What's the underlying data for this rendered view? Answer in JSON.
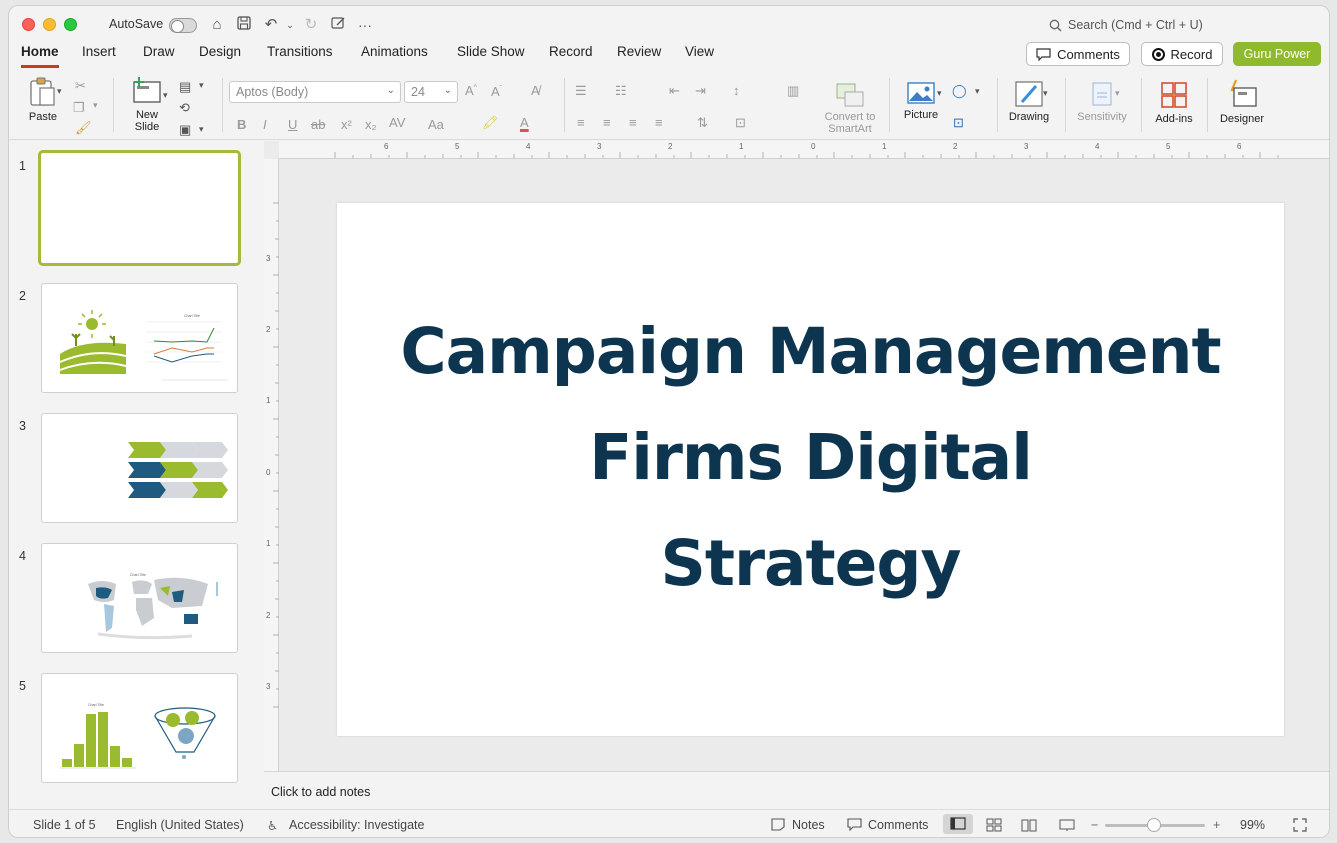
{
  "titlebar": {
    "autosave_label": "AutoSave",
    "search_placeholder": "Search (Cmd + Ctrl + U)"
  },
  "tabs": [
    {
      "label": "Home",
      "active": true
    },
    {
      "label": "Insert"
    },
    {
      "label": "Draw"
    },
    {
      "label": "Design"
    },
    {
      "label": "Transitions"
    },
    {
      "label": "Animations"
    },
    {
      "label": "Slide Show"
    },
    {
      "label": "Record"
    },
    {
      "label": "Review"
    },
    {
      "label": "View"
    }
  ],
  "header_buttons": {
    "comments": "Comments",
    "record": "Record",
    "guru": "Guru Power"
  },
  "ribbon": {
    "paste": "Paste",
    "new_slide_1": "New",
    "new_slide_2": "Slide",
    "font_name": "Aptos (Body)",
    "font_size": "24",
    "convert_1": "Convert to",
    "convert_2": "SmartArt",
    "picture": "Picture",
    "drawing": "Drawing",
    "sensitivity": "Sensitivity",
    "addins": "Add-ins",
    "designer": "Designer"
  },
  "thumbnails": [
    {
      "num": "1"
    },
    {
      "num": "2"
    },
    {
      "num": "3"
    },
    {
      "num": "4"
    },
    {
      "num": "5"
    }
  ],
  "slide": {
    "title_line1": "Campaign Management",
    "title_line2": "Firms Digital",
    "title_line3": "Strategy"
  },
  "notes_placeholder": "Click to add notes",
  "status": {
    "slide_count": "Slide 1 of 5",
    "language": "English (United States)",
    "accessibility": "Accessibility: Investigate",
    "notes": "Notes",
    "comments": "Comments",
    "zoom": "99%",
    "zoom_level_percent": 99
  },
  "colors": {
    "accent_tab": "#c43e1c",
    "guru_button": "#8fba2e",
    "title_text": "#0e3550",
    "thumb_green": "#9bbb2e",
    "thumb_navy": "#1f5a80"
  }
}
